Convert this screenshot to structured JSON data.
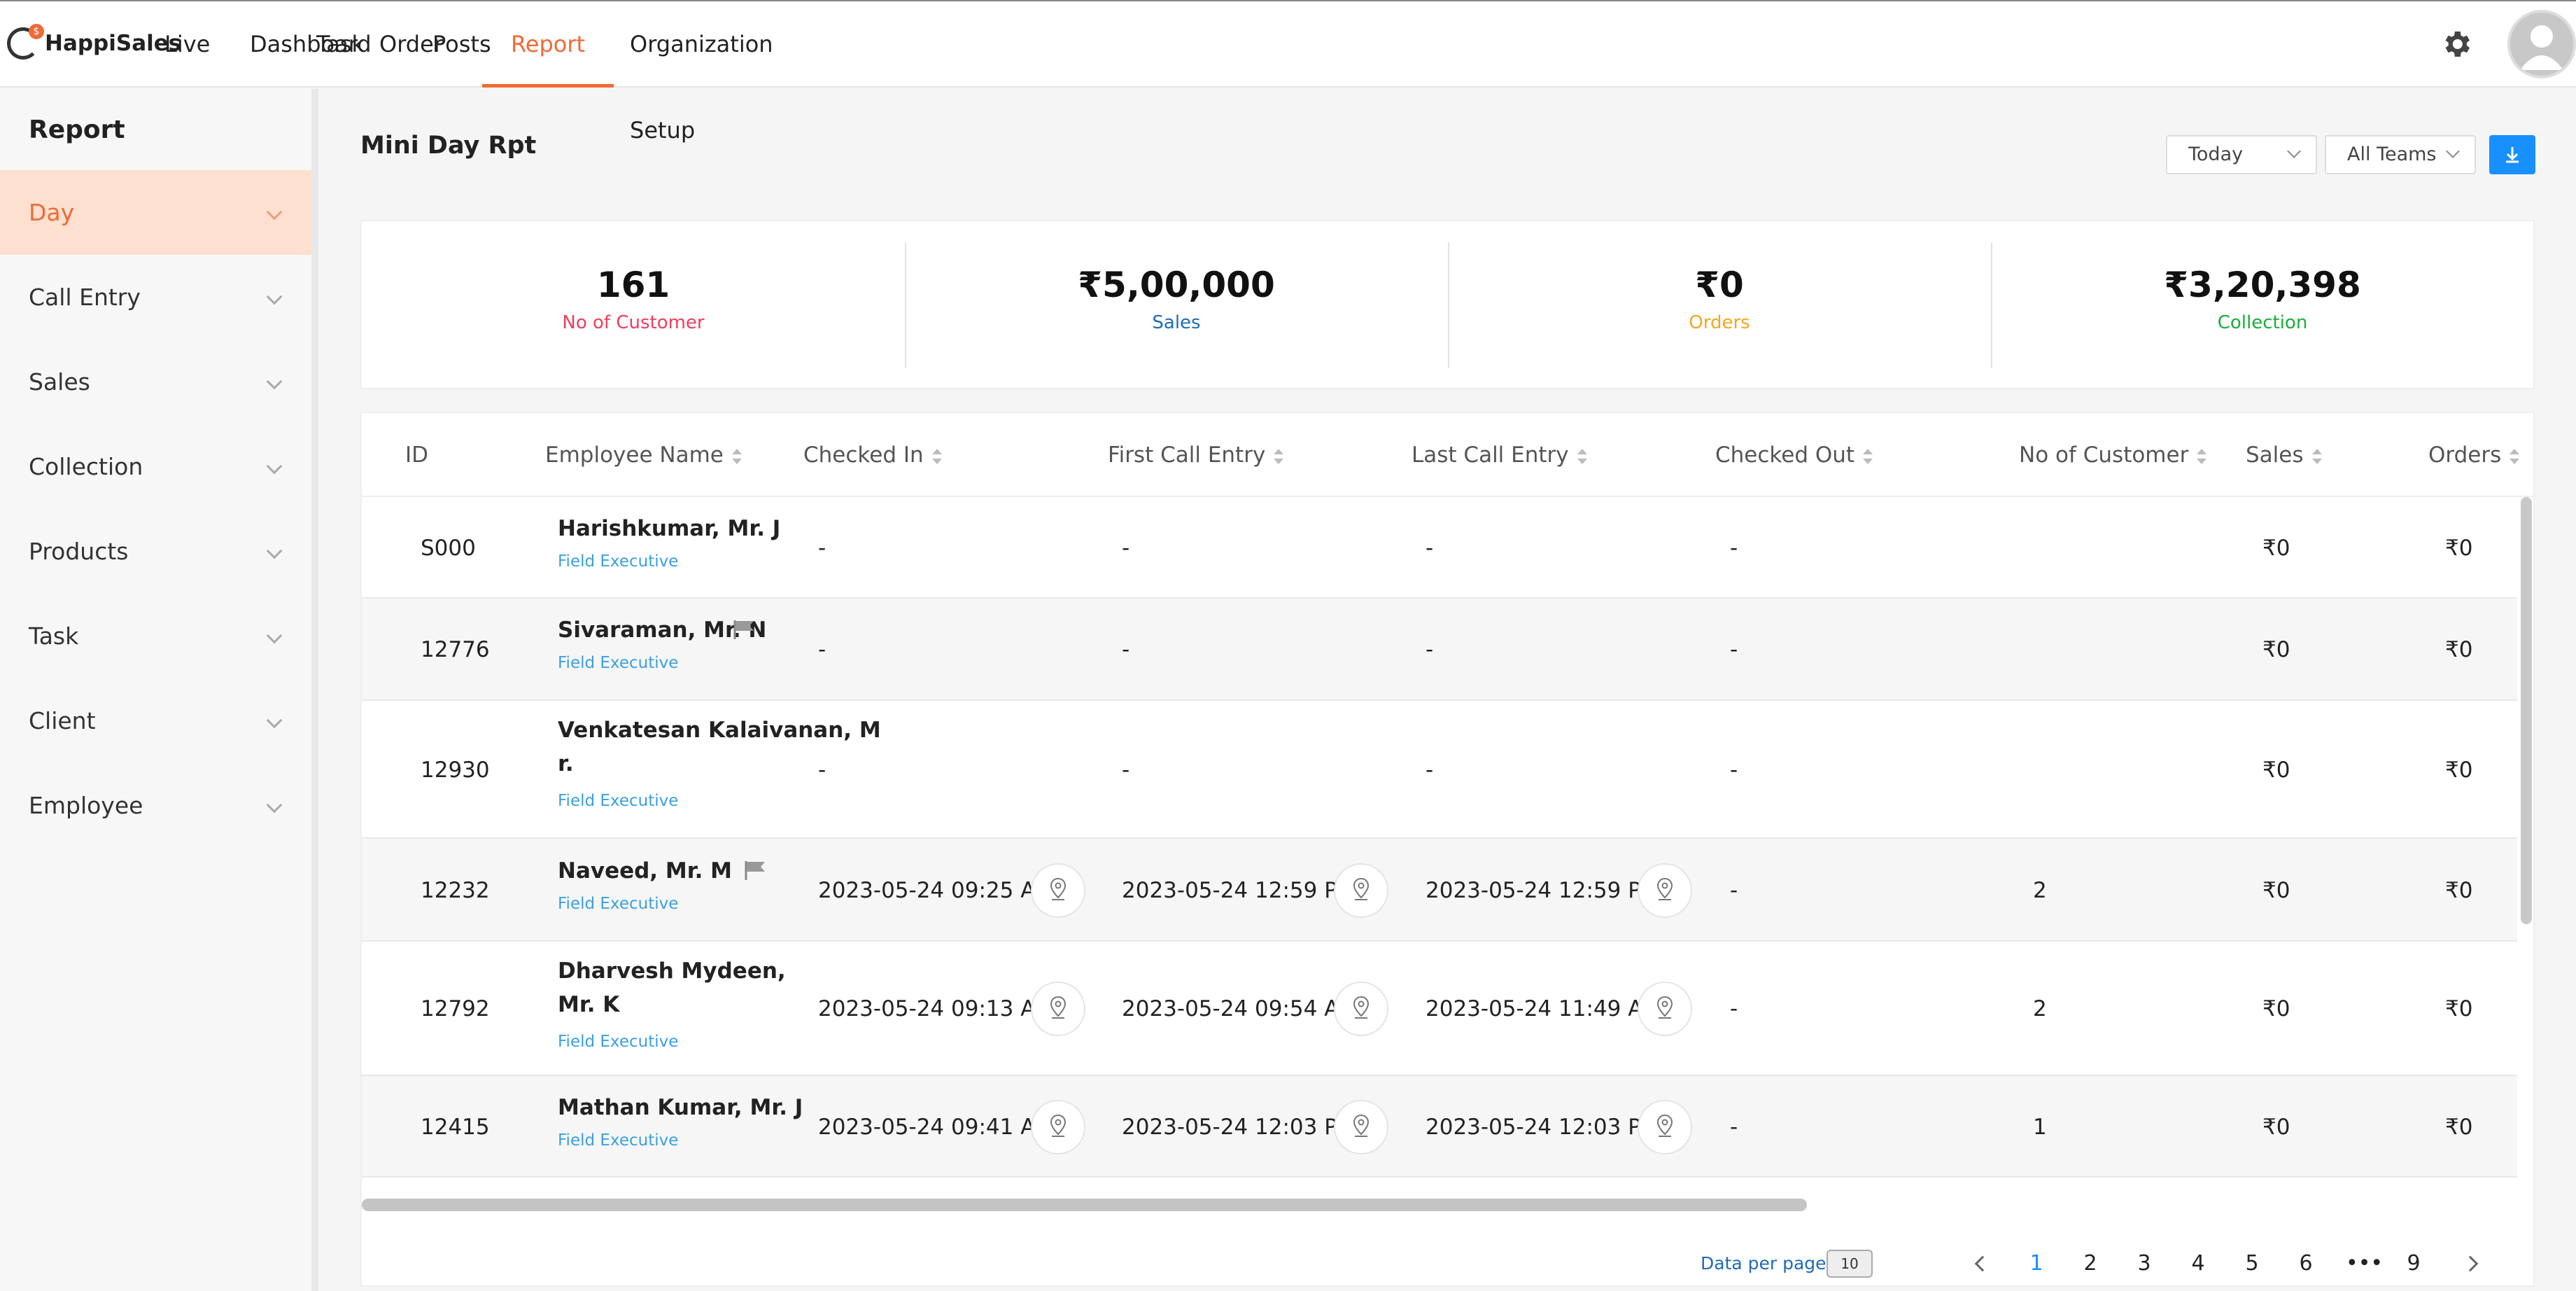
{
  "brand": {
    "name": "HappiSales"
  },
  "nav": {
    "items": [
      "Live Tracking",
      "Dashboard",
      "Task",
      "Order",
      "Posts",
      "Report",
      "Organization Setup"
    ],
    "active": "Report"
  },
  "sidebar": {
    "title": "Report",
    "items": [
      "Day",
      "Call Entry",
      "Sales",
      "Collection",
      "Products",
      "Task",
      "Client",
      "Employee"
    ],
    "active": "Day"
  },
  "page": {
    "title": "Mini Day Rpt",
    "filters": {
      "period": "Today",
      "team": "All Teams"
    }
  },
  "kpis": [
    {
      "value": "161",
      "label": "No of Customer",
      "color": "#ef3e5c"
    },
    {
      "value": "₹5,00,000",
      "label": "Sales",
      "color": "#1e6bb8"
    },
    {
      "value": "₹0",
      "label": "Orders",
      "color": "#f5a623"
    },
    {
      "value": "₹3,20,398",
      "label": "Collection",
      "color": "#1aae3a"
    }
  ],
  "table": {
    "columns": [
      "ID",
      "Employee Name",
      "Checked In",
      "First Call Entry",
      "Last Call Entry",
      "Checked Out",
      "No of Customer",
      "Sales",
      "Orders"
    ],
    "rows": [
      {
        "id": "S000",
        "name": "Harishkumar, Mr. J",
        "name2": "",
        "role": "Field Executive",
        "flag": false,
        "checked_in": "-",
        "first_call": "-",
        "last_call": "-",
        "checked_out": "-",
        "customers": "",
        "sales": "₹0",
        "orders": "₹0"
      },
      {
        "id": "12776",
        "name": "Sivaraman, Mr. N",
        "name2": "",
        "role": "Field Executive",
        "flag": true,
        "checked_in": "-",
        "first_call": "-",
        "last_call": "-",
        "checked_out": "-",
        "customers": "",
        "sales": "₹0",
        "orders": "₹0"
      },
      {
        "id": "12930",
        "name": "Venkatesan Kalaivanan, M",
        "name2": "r.",
        "role": "Field Executive",
        "flag": false,
        "checked_in": "-",
        "first_call": "-",
        "last_call": "-",
        "checked_out": "-",
        "customers": "",
        "sales": "₹0",
        "orders": "₹0"
      },
      {
        "id": "12232",
        "name": "Naveed, Mr. M",
        "name2": "",
        "role": "Field Executive",
        "flag": true,
        "checked_in": "2023-05-24 09:25 AM",
        "first_call": "2023-05-24 12:59 PM",
        "last_call": "2023-05-24 12:59 PM",
        "checked_out": "-",
        "customers": "2",
        "sales": "₹0",
        "orders": "₹0"
      },
      {
        "id": "12792",
        "name": "Dharvesh Mydeen,",
        "name2": "Mr. K",
        "role": "Field Executive",
        "flag": false,
        "checked_in": "2023-05-24 09:13 AM",
        "first_call": "2023-05-24 09:54 AM",
        "last_call": "2023-05-24 11:49 AM",
        "checked_out": "-",
        "customers": "2",
        "sales": "₹0",
        "orders": "₹0"
      },
      {
        "id": "12415",
        "name": "Mathan Kumar, Mr. J",
        "name2": "",
        "role": "Field Executive",
        "flag": false,
        "checked_in": "2023-05-24 09:41 AM",
        "first_call": "2023-05-24 12:03 PM",
        "last_call": "2023-05-24 12:03 PM",
        "checked_out": "-",
        "customers": "1",
        "sales": "₹0",
        "orders": "₹0"
      }
    ]
  },
  "pagination": {
    "label": "Data per page",
    "page_size": "10",
    "pages": [
      "1",
      "2",
      "3",
      "4",
      "5",
      "6",
      "•••",
      "9"
    ],
    "current": "1"
  }
}
